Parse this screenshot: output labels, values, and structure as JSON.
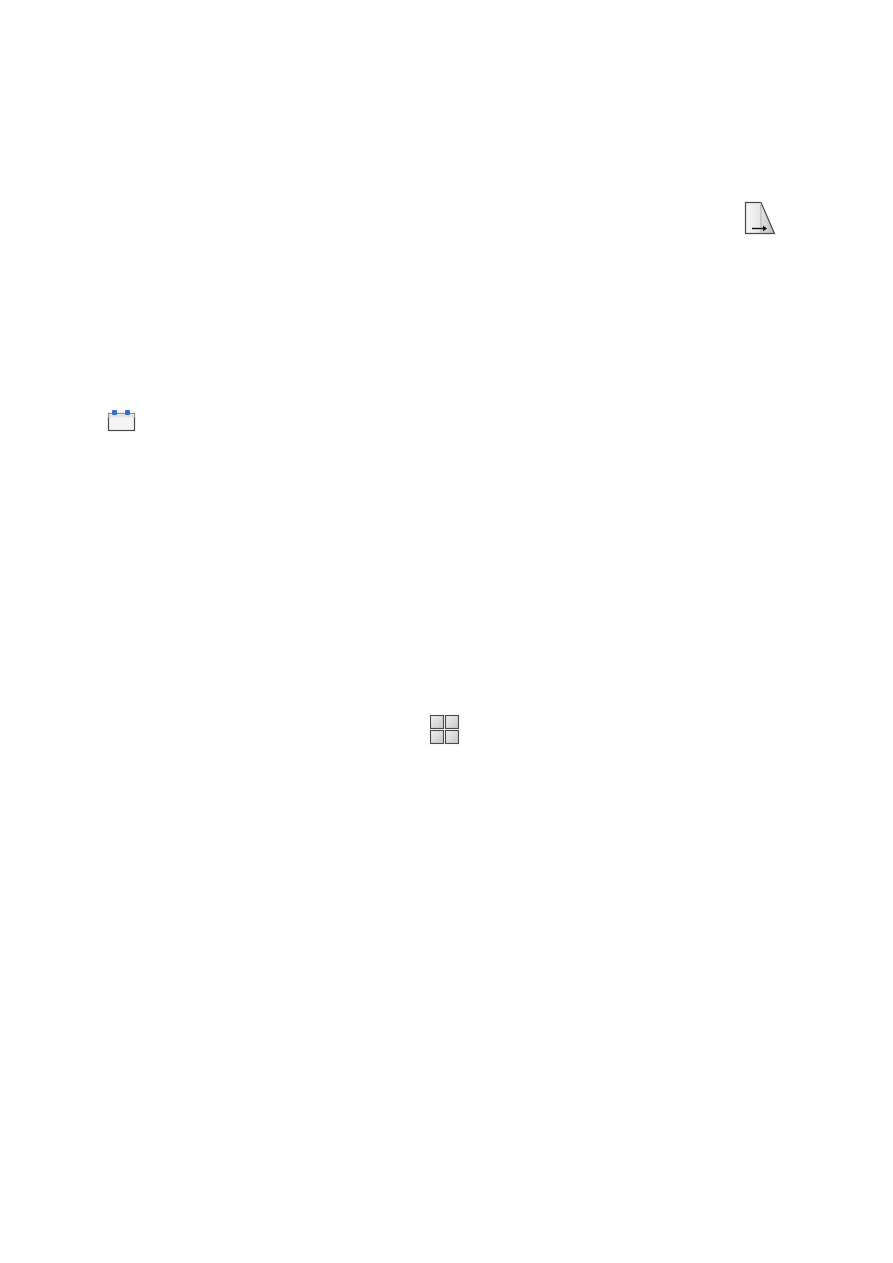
{
  "icons": {
    "export_page": {
      "name": "page-export-icon"
    },
    "layout_tab": {
      "name": "layout-tab-icon",
      "accent": "#2f6fd6"
    },
    "viewports": {
      "name": "four-viewports-icon"
    }
  },
  "colors": {
    "background": "#ffffff",
    "icon_outline": "#4a4a4a",
    "icon_fill_light": "#f2f2f2",
    "icon_fill_shade": "#c8c8c8",
    "accent_blue": "#2f6fd6"
  }
}
